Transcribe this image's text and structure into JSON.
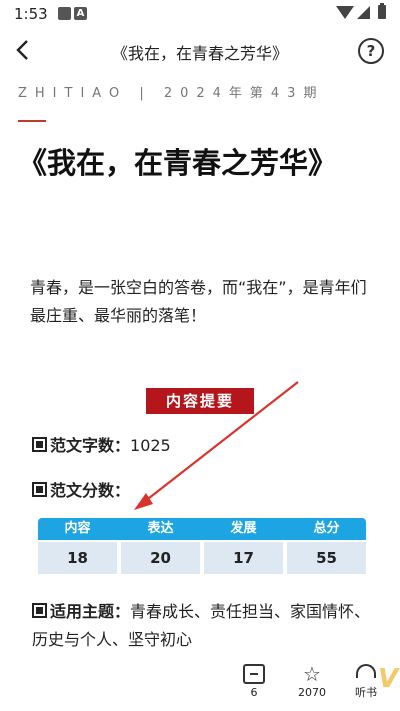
{
  "status_bar": {
    "time": "1:53",
    "a_icon": "A"
  },
  "header": {
    "title": "《我在，在青春之芳华》",
    "help_icon": "?"
  },
  "issue_line": "ZHITIAO | 2024年第43期",
  "headline": "《我在，在青春之芳华》",
  "intro": "青春，是一张空白的答卷，而“我在”，是青年们最庄重、最华丽的落笔！",
  "summary_badge": "内容提要",
  "word_count": {
    "label": "范文字数：",
    "value": "1025"
  },
  "score_label": "范文分数：",
  "score_table": {
    "headers": [
      "内容",
      "表达",
      "发展",
      "总分"
    ],
    "values": [
      "18",
      "20",
      "17",
      "55"
    ]
  },
  "themes": {
    "label": "适用主题：",
    "value": "青春成长、责任担当、家国情怀、历史与个人、坚守初心"
  },
  "toolbar": {
    "comment_count": "6",
    "favorite_count": "2070",
    "listen_label": "听书"
  },
  "colors": {
    "accent_red": "#b5161b",
    "table_blue": "#1da4e3",
    "cell_bg": "#dde8f3"
  }
}
